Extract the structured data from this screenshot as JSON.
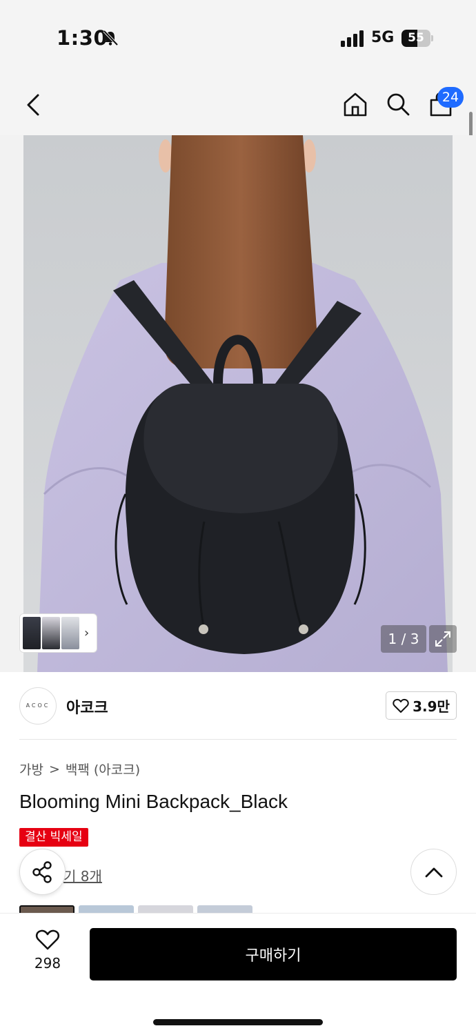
{
  "status": {
    "time": "1:30",
    "network": "5G",
    "battery": "55",
    "battery_level": 0.55
  },
  "header": {
    "cart_count": "24"
  },
  "gallery": {
    "page_indicator": "1 / 3"
  },
  "brand": {
    "logo_text": "ACOC",
    "name": "아코크",
    "likes": "3.9만"
  },
  "breadcrumb": {
    "category": "가방",
    "separator": ">",
    "subcategory": "백팩 (아코크)"
  },
  "product": {
    "title": "Blooming Mini Backpack_Black",
    "sale_badge": "결산 빅세일",
    "review_link": "기 8개"
  },
  "bottom": {
    "wish_count": "298",
    "buy_label": "구매하기"
  },
  "colors": {
    "accent_blue": "#1f6bff",
    "sale_red": "#e60012",
    "buy_black": "#000000"
  }
}
